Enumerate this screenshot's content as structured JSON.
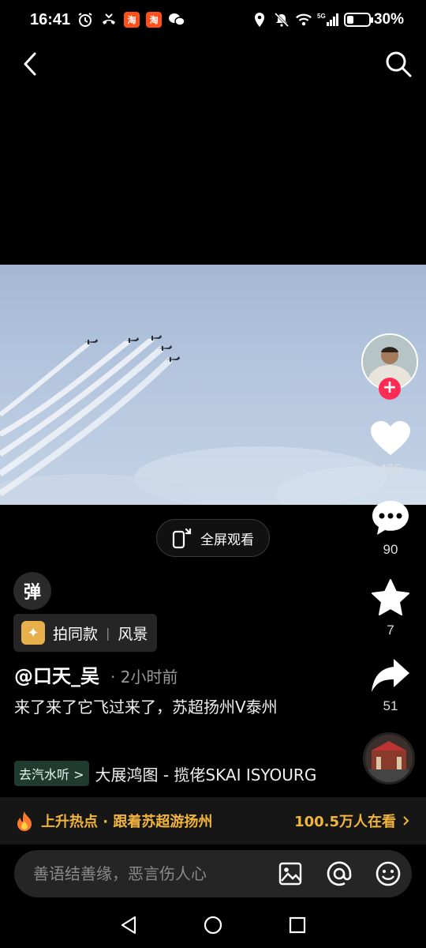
{
  "status_bar": {
    "time": "16:41",
    "network": "5G",
    "battery_percent": "30%",
    "battery_level": 0.3
  },
  "video": {
    "fullscreen_label": "全屏观看"
  },
  "actions": {
    "like_count": "495",
    "comment_count": "90",
    "favorite_count": "7",
    "share_count": "51"
  },
  "info": {
    "danmu_label": "弹",
    "template_label": "拍同款",
    "template_category": "风景",
    "author": "@口天_吴",
    "post_time": "· 2小时前",
    "caption": "来了来了它飞过来了，苏超扬州V泰州",
    "music_tag": "去汽水听 >",
    "music_title": "大展鸿图 - 揽佬SKAI ISYOURG"
  },
  "hot_bar": {
    "topic": "上升热点 · 跟着苏超游扬州",
    "viewers": "100.5万人在看"
  },
  "comment": {
    "placeholder": "善语结善缘，恶言伤人心"
  },
  "colors": {
    "accent_red": "#fe2c55",
    "hot_gold": "#f2b53c",
    "sky": "#b4c6de"
  },
  "icons": [
    "back-icon",
    "search-icon",
    "fullscreen-icon",
    "heart-icon",
    "comment-icon",
    "star-icon",
    "share-icon",
    "fire-icon",
    "image-icon",
    "at-icon",
    "emoji-icon",
    "nav-back-icon",
    "nav-home-icon",
    "nav-recents-icon"
  ]
}
